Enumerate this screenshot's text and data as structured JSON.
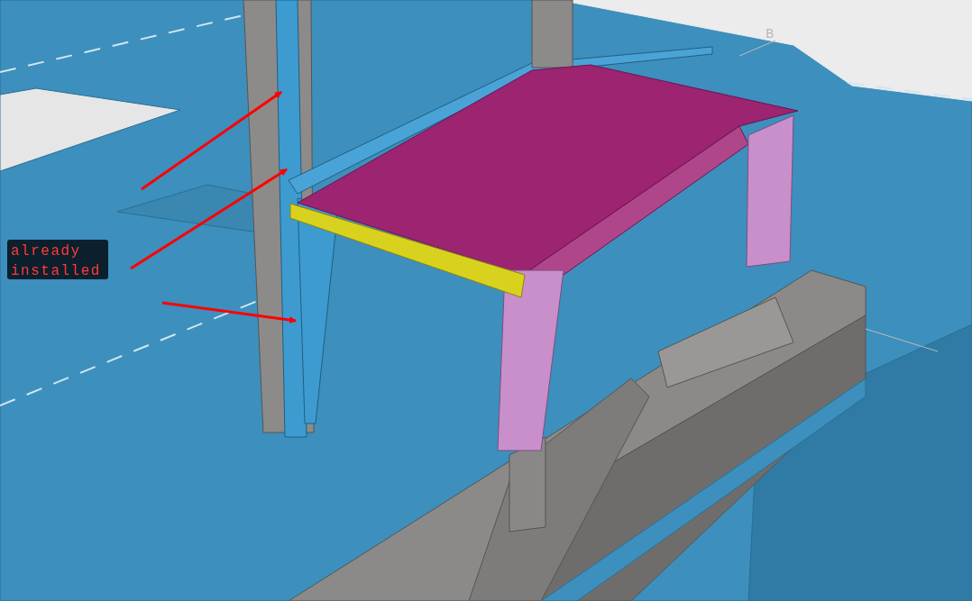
{
  "viewport": {
    "grid_label": "B",
    "annotation": {
      "lines": [
        "already",
        "installed"
      ]
    }
  }
}
